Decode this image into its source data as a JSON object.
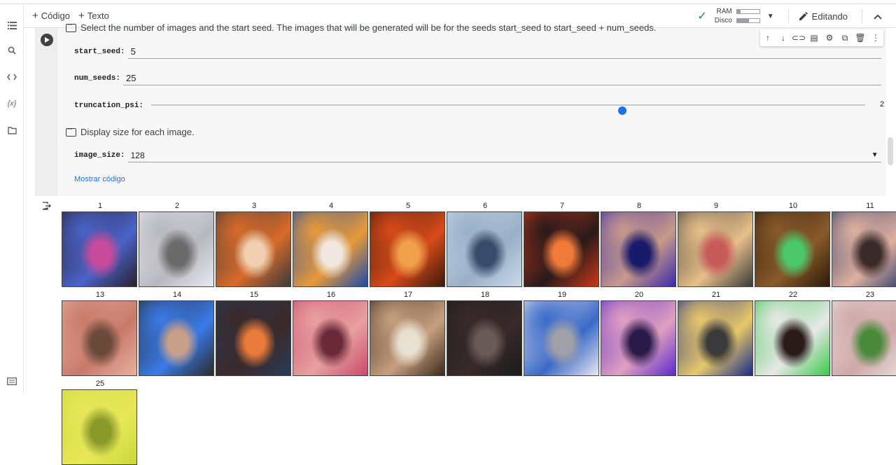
{
  "toolbar": {
    "add_code": "Código",
    "add_text": "Texto",
    "ram_label": "RAM",
    "disk_label": "Disco",
    "ram_level": 0.15,
    "disk_level": 0.55,
    "editing": "Editando"
  },
  "cell": {
    "description": "Select the number of images and the start seed. The images that will be generated will be for the seeds start_seed to start_seed + num_seeds.",
    "start_seed_label": "start_seed:",
    "start_seed_value": "5",
    "num_seeds_label": "num_seeds:",
    "num_seeds_value": "25",
    "truncation_label": "truncation_psi:",
    "truncation_value": "2",
    "truncation_fraction": 0.66,
    "display_description": "Display size for each image.",
    "image_size_label": "image_size:",
    "image_size_value": "128",
    "show_code": "Mostrar código"
  },
  "images": [
    {
      "n": "1",
      "c": [
        "#2a2030",
        "#4a63c8",
        "#c84a9a"
      ]
    },
    {
      "n": "2",
      "c": [
        "#e8e8ee",
        "#b8b8c0",
        "#6a6a6a"
      ]
    },
    {
      "n": "3",
      "c": [
        "#3a3a3a",
        "#d86a2a",
        "#f0d0b0"
      ]
    },
    {
      "n": "4",
      "c": [
        "#1a4aa8",
        "#e89a3a",
        "#f0e8e0"
      ]
    },
    {
      "n": "5",
      "c": [
        "#3a1a0a",
        "#d84a1a",
        "#f0a04a"
      ]
    },
    {
      "n": "6",
      "c": [
        "#c8d8e8",
        "#9ab0c8",
        "#3a4a6a"
      ]
    },
    {
      "n": "7",
      "c": [
        "#c83a1a",
        "#2a1a1a",
        "#f07a3a"
      ]
    },
    {
      "n": "8",
      "c": [
        "#3a2aa8",
        "#c89a8a",
        "#1a1a6a"
      ]
    },
    {
      "n": "9",
      "c": [
        "#3a3a3a",
        "#e8c08a",
        "#c85a5a"
      ]
    },
    {
      "n": "10",
      "c": [
        "#2a1a0a",
        "#8a5a2a",
        "#4ac86a"
      ]
    },
    {
      "n": "11",
      "c": [
        "#2a3a6a",
        "#e0b0a0",
        "#3a2a2a"
      ]
    },
    {
      "n": "13",
      "c": [
        "#e8b0a0",
        "#c87a6a",
        "#6a4a3a"
      ]
    },
    {
      "n": "14",
      "c": [
        "#2a2a2a",
        "#3a7ae8",
        "#c8a08a"
      ]
    },
    {
      "n": "15",
      "c": [
        "#2a3a5a",
        "#3a2a2a",
        "#e87a3a"
      ]
    },
    {
      "n": "16",
      "c": [
        "#c84a6a",
        "#e8a0a0",
        "#6a2a3a"
      ]
    },
    {
      "n": "17",
      "c": [
        "#3a2a1a",
        "#c8a080",
        "#e8e0d0"
      ]
    },
    {
      "n": "18",
      "c": [
        "#1a1a1a",
        "#3a2a2a",
        "#6a5a5a"
      ]
    },
    {
      "n": "19",
      "c": [
        "#e8e8f0",
        "#3a6ac8",
        "#a0a0a8"
      ]
    },
    {
      "n": "20",
      "c": [
        "#5a2ac8",
        "#e0a0c0",
        "#2a1a4a"
      ]
    },
    {
      "n": "21",
      "c": [
        "#1a2a8a",
        "#e8c86a",
        "#3a3a3a"
      ]
    },
    {
      "n": "22",
      "c": [
        "#3ac84a",
        "#e8e8e8",
        "#2a1a1a"
      ]
    },
    {
      "n": "23",
      "c": [
        "#e8e0e0",
        "#d0a8a8",
        "#4a8a3a"
      ]
    },
    {
      "n": "25",
      "c": [
        "#c8d83a",
        "#e8e85a",
        "#8a9a2a"
      ]
    }
  ]
}
